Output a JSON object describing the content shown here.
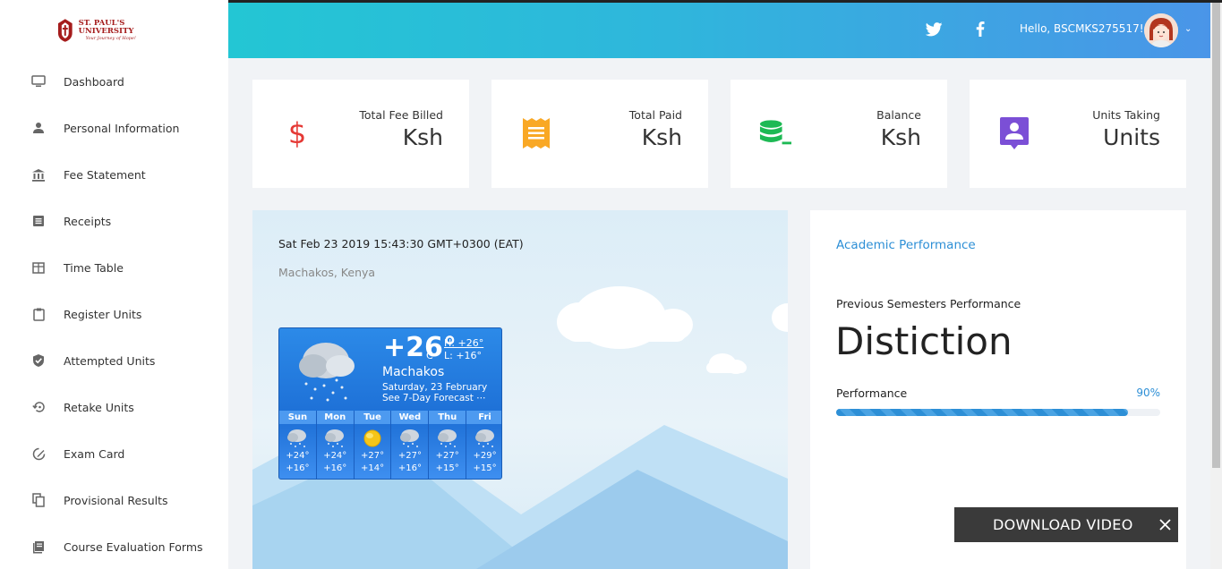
{
  "logo": {
    "name": "ST. PAUL'S UNIVERSITY",
    "motto": "Your Journey of Hope!"
  },
  "sidebar": {
    "items": [
      {
        "label": "Dashboard",
        "icon": "monitor-icon"
      },
      {
        "label": "Personal Information",
        "icon": "person-icon"
      },
      {
        "label": "Fee Statement",
        "icon": "bank-icon"
      },
      {
        "label": "Receipts",
        "icon": "receipt-icon"
      },
      {
        "label": "Time Table",
        "icon": "table-icon"
      },
      {
        "label": "Register Units",
        "icon": "clipboard-icon"
      },
      {
        "label": "Attempted Units",
        "icon": "shield-check-icon"
      },
      {
        "label": "Retake Units",
        "icon": "history-icon"
      },
      {
        "label": "Exam Card",
        "icon": "edit-icon"
      },
      {
        "label": "Provisional Results",
        "icon": "copy-icon"
      },
      {
        "label": "Course Evaluation Forms",
        "icon": "book-icon"
      }
    ]
  },
  "header": {
    "greeting": "Hello, BSCMKS275517!"
  },
  "cards": [
    {
      "label": "Total Fee Billed",
      "value": "Ksh",
      "icon": "dollar-icon",
      "color": "#e53935"
    },
    {
      "label": "Total Paid",
      "value": "Ksh",
      "icon": "receipt-icon",
      "color": "#f9a825"
    },
    {
      "label": "Balance",
      "value": "Ksh",
      "icon": "database-minus-icon",
      "color": "#1db954"
    },
    {
      "label": "Units Taking",
      "value": "Units",
      "icon": "account-box-icon",
      "color": "#7b4fd6"
    }
  ],
  "weather": {
    "datetime": "Sat Feb 23 2019 15:43:30 GMT+0300 (EAT)",
    "location": "Machakos, Kenya",
    "temp": "+26°",
    "unit": "C",
    "high": "H: +26°",
    "low": "L: +16°",
    "city": "Machakos",
    "day": "Saturday, 23 February",
    "forecast_link": "See 7-Day Forecast",
    "forecast": [
      {
        "day": "Sun",
        "hi": "+24°",
        "lo": "+16°",
        "icon": "rain-cloud-icon"
      },
      {
        "day": "Mon",
        "hi": "+24°",
        "lo": "+16°",
        "icon": "rain-cloud-icon"
      },
      {
        "day": "Tue",
        "hi": "+27°",
        "lo": "+14°",
        "icon": "sun-icon"
      },
      {
        "day": "Wed",
        "hi": "+27°",
        "lo": "+16°",
        "icon": "rain-cloud-icon"
      },
      {
        "day": "Thu",
        "hi": "+27°",
        "lo": "+15°",
        "icon": "rain-cloud-icon"
      },
      {
        "day": "Fri",
        "hi": "+29°",
        "lo": "+15°",
        "icon": "rain-cloud-icon"
      }
    ]
  },
  "academic": {
    "title": "Academic Performance",
    "subtitle": "Previous Semesters Performance",
    "grade": "Distiction",
    "perf_label": "Performance",
    "perf_value": "90%",
    "perf_fraction": 0.9
  },
  "download": {
    "label": "DOWNLOAD VIDEO"
  },
  "colors": {
    "accent": "#2d8fd6",
    "sidebar_bg": "#ffffff",
    "topbar_start": "#23c6d4",
    "topbar_end": "#4a95e8"
  }
}
